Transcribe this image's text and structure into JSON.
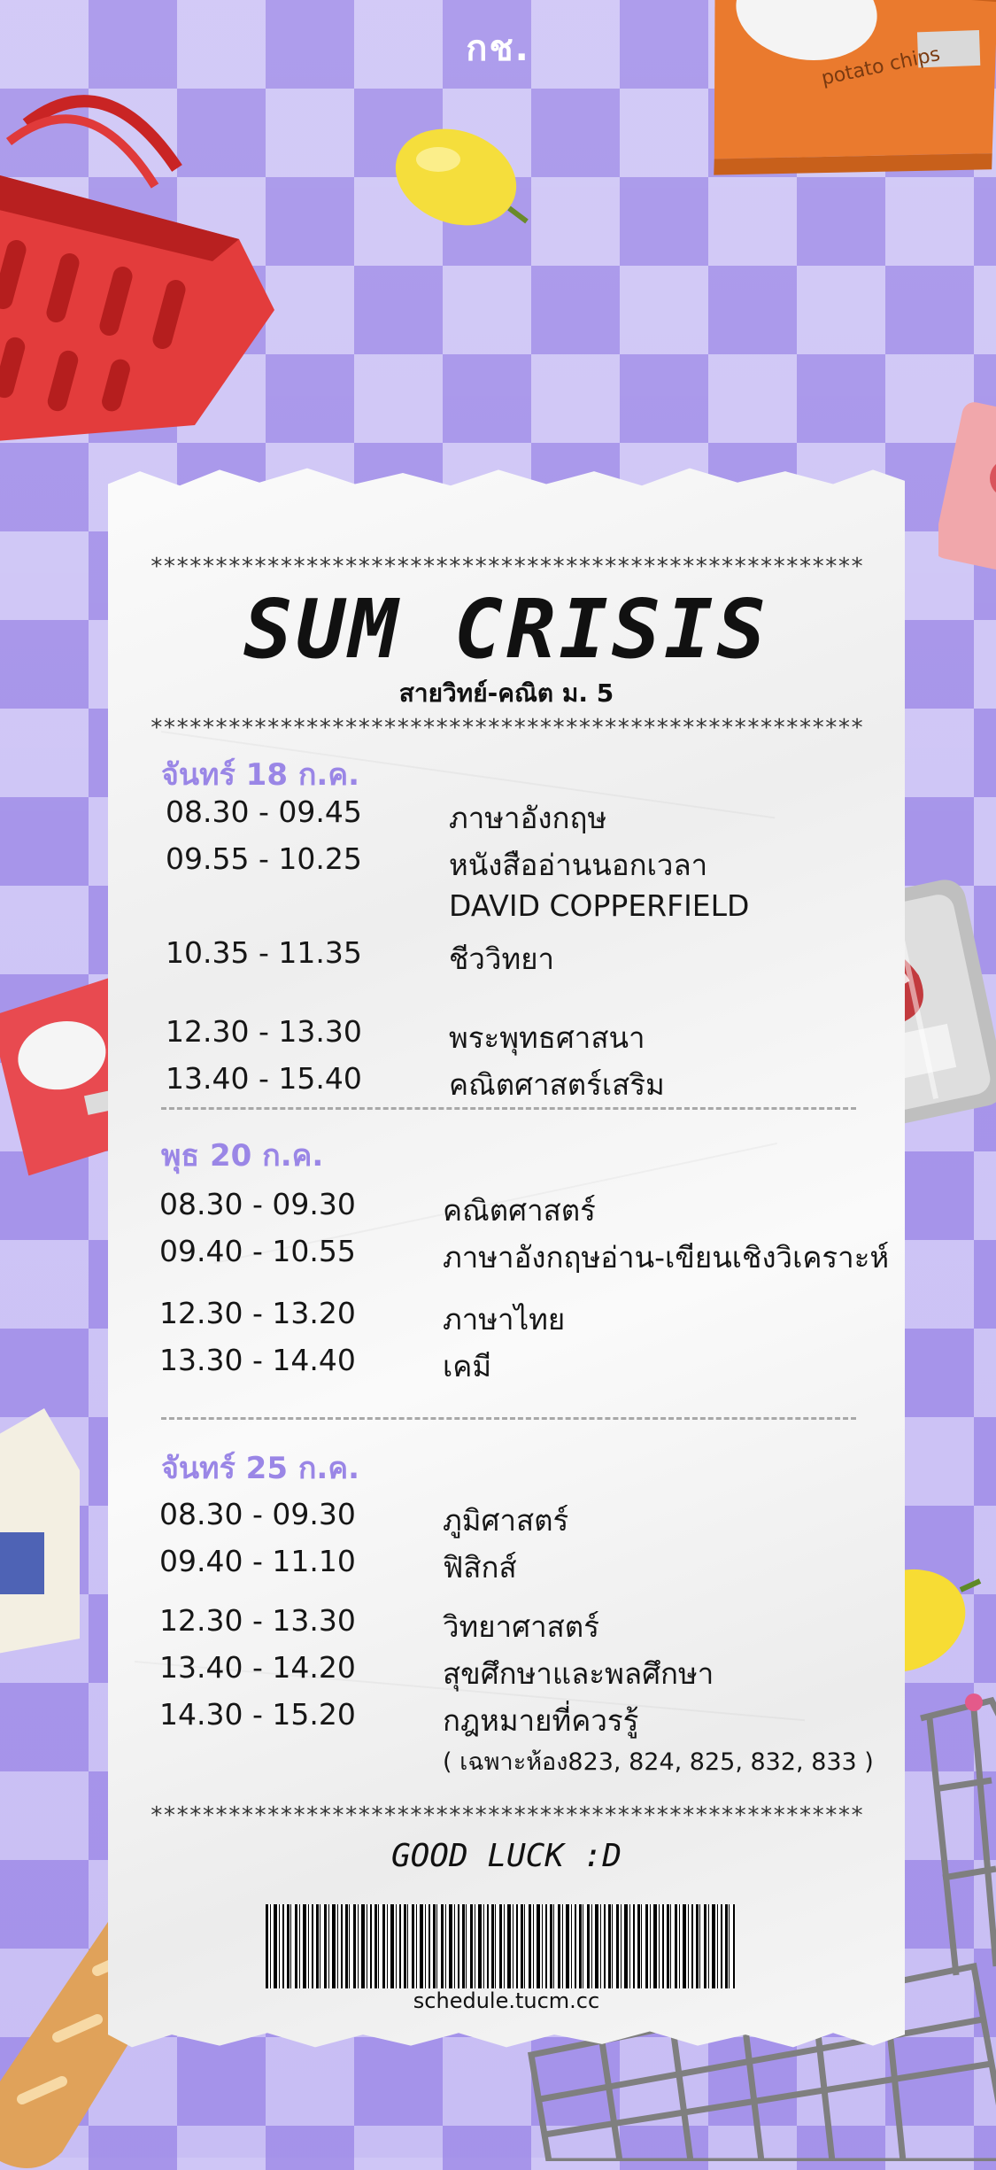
{
  "header": {
    "code": "กช."
  },
  "receipt": {
    "stars": "*******************************************************",
    "title": "SUM CRISIS",
    "subtitle": "สายวิทย์-คณิต ม. 5",
    "days": [
      {
        "label": "จันทร์ 18 ก.ค.",
        "rows": [
          {
            "time": "08.30 - 09.45",
            "subject": "ภาษาอังกฤษ"
          },
          {
            "time": "09.55 - 10.25",
            "subject": "หนังสืออ่านนอกเวลา"
          },
          {
            "time": "",
            "subject": "DAVID COPPERFIELD"
          },
          {
            "time": "10.35 - 11.35",
            "subject": "ชีววิทยา"
          },
          {
            "time": "12.30 - 13.30",
            "subject": "พระพุทธศาสนา"
          },
          {
            "time": "13.40 - 15.40",
            "subject": "คณิตศาสตร์เสริม"
          }
        ]
      },
      {
        "label": "พุธ 20 ก.ค.",
        "rows": [
          {
            "time": "08.30 - 09.30",
            "subject": "คณิตศาสตร์"
          },
          {
            "time": "09.40 - 10.55",
            "subject": "ภาษาอังกฤษอ่าน-เขียนเชิงวิเคราะห์"
          },
          {
            "time": "12.30 - 13.20",
            "subject": "ภาษาไทย"
          },
          {
            "time": "13.30 - 14.40",
            "subject": "เคมี"
          }
        ]
      },
      {
        "label": "จันทร์ 25 ก.ค.",
        "rows": [
          {
            "time": "08.30 - 09.30",
            "subject": "ภูมิศาสตร์"
          },
          {
            "time": "09.40 - 11.10",
            "subject": "ฟิสิกส์"
          },
          {
            "time": "12.30 - 13.30",
            "subject": "วิทยาศาสตร์"
          },
          {
            "time": "13.40 - 14.20",
            "subject": "สุขศึกษาและพลศึกษา"
          },
          {
            "time": "14.30 - 15.20",
            "subject": "กฎหมายที่ควรรู้"
          }
        ],
        "note": "( เฉพาะห้อง823, 824, 825, 832, 833 )"
      }
    ],
    "footer": "GOOD LUCK :D",
    "barcode_text": "schedule.tucm.cc"
  },
  "decorations": {
    "chips_text": "potato chips",
    "colors": {
      "background": "#a795ea",
      "accent": "#9a86e6",
      "basket": "#e23b3b",
      "chips": "#ea7a2e"
    }
  }
}
